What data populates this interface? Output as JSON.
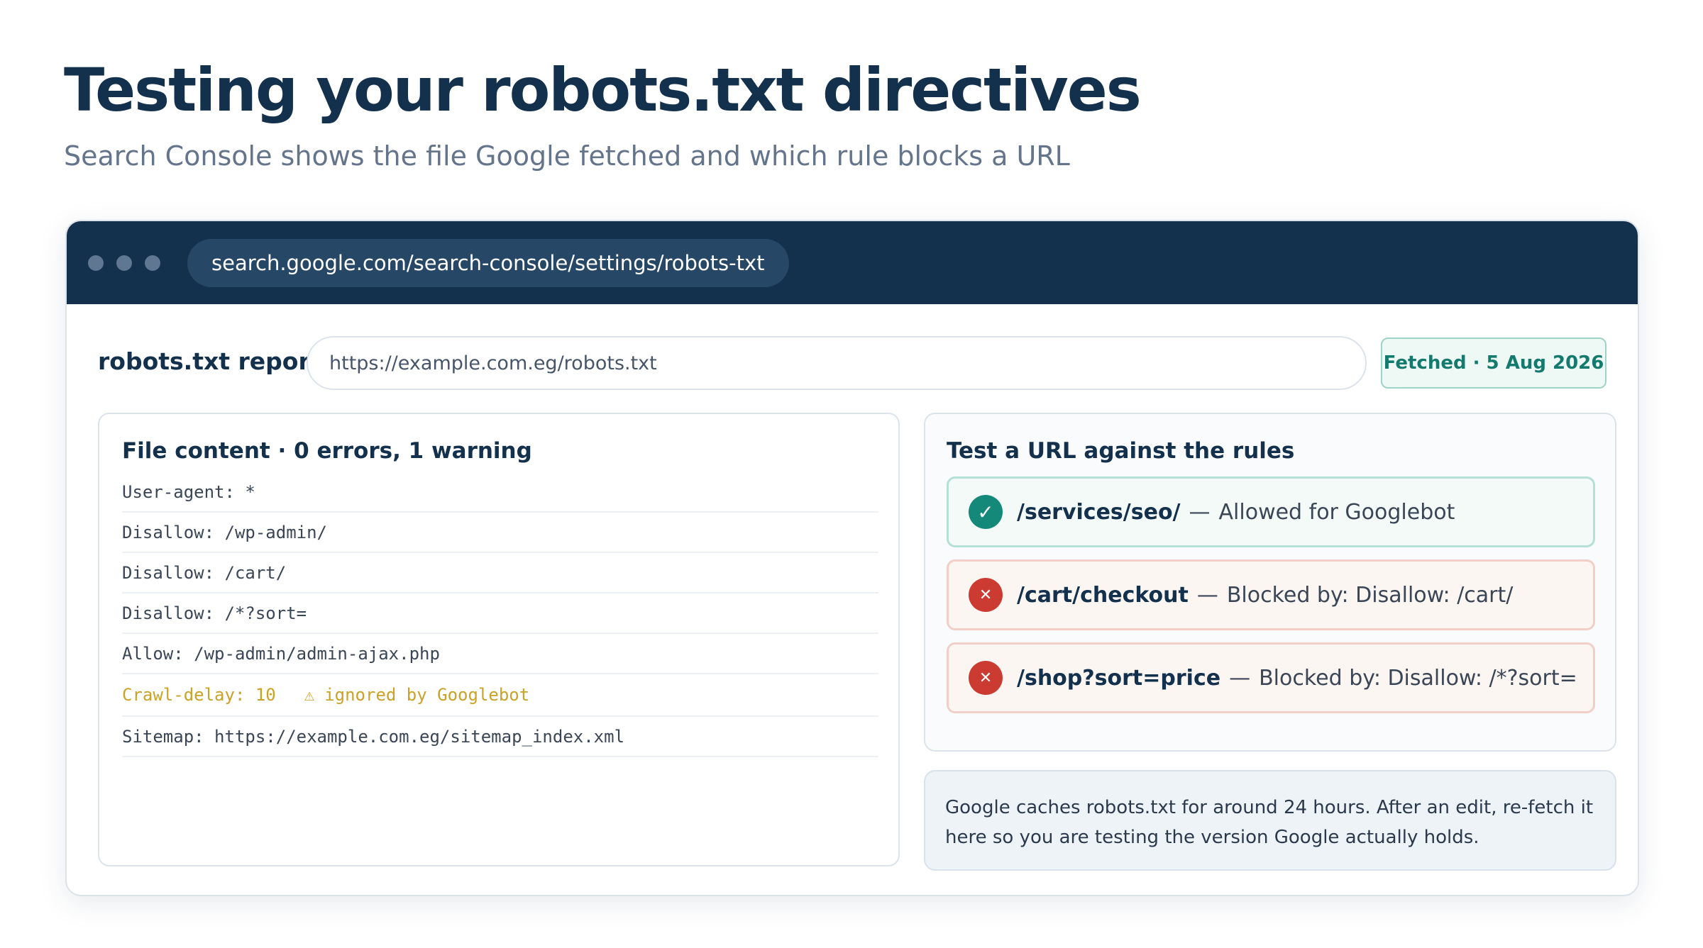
{
  "page": {
    "title": "Testing your robots.txt directives",
    "subtitle": "Search Console shows the file Google fetched and which rule blocks a URL"
  },
  "browser": {
    "url": "search.google.com/search-console/settings/robots-txt"
  },
  "report": {
    "label": "robots.txt report",
    "input_value": "https://example.com.eg/robots.txt",
    "fetched_badge": "Fetched · 5 Aug 2026"
  },
  "file_panel": {
    "heading": "File content · 0 errors, 1 warning",
    "lines": [
      "User-agent: *",
      "Disallow: /wp-admin/",
      "Disallow: /cart/",
      "Disallow: /*?sort=",
      "Allow: /wp-admin/admin-ajax.php",
      "Crawl-delay: 10",
      "Sitemap: https://example.com.eg/sitemap_index.xml"
    ],
    "warning_note": "ignored by Googlebot",
    "warning_icon": "warning-triangle-icon"
  },
  "test_panel": {
    "heading": "Test a URL against the rules",
    "separator": "—",
    "results": [
      {
        "path": "/services/seo/",
        "result": "Allowed for Googlebot",
        "status": "allowed",
        "icon": "check-icon"
      },
      {
        "path": "/cart/checkout",
        "result": "Blocked by: Disallow: /cart/",
        "status": "blocked",
        "icon": "close-icon"
      },
      {
        "path": "/shop?sort=price",
        "result": "Blocked by: Disallow: /*?sort=",
        "status": "blocked",
        "icon": "close-icon"
      }
    ]
  },
  "note": {
    "text": "Google caches robots.txt for around 24 hours. After an edit, re-fetch it here so you are testing the version Google actually holds."
  },
  "colors": {
    "navy": "#13304d",
    "allowed": "#14897a",
    "blocked": "#cc3b32",
    "warning": "#c9a227"
  }
}
